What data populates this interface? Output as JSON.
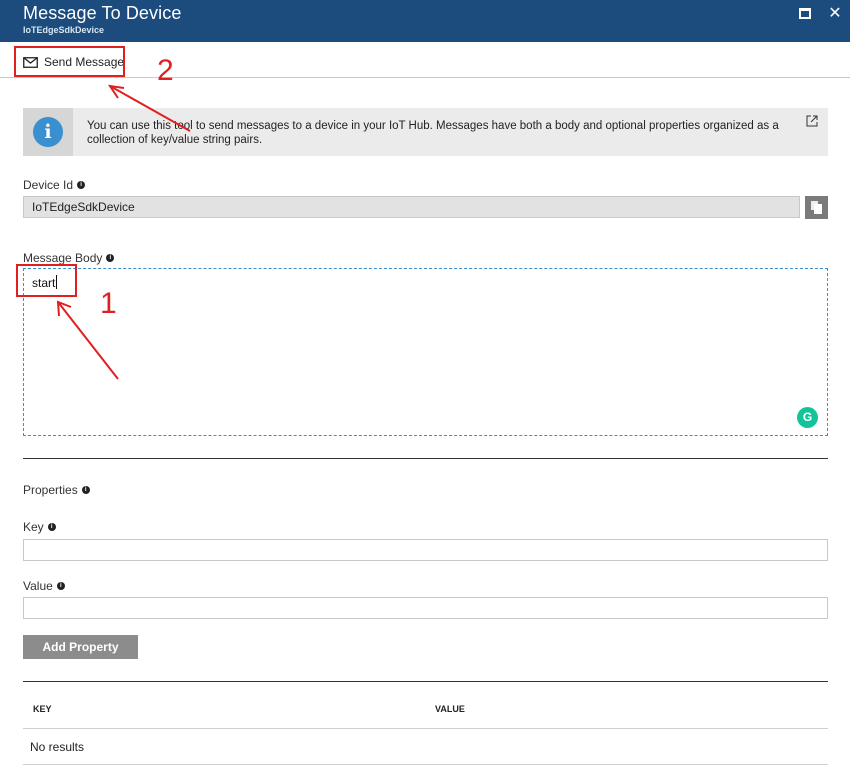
{
  "window": {
    "title": "Message To Device",
    "subtitle": "IoTEdgeSdkDevice",
    "maximize_icon": "maximize-icon",
    "close_icon": "close-icon",
    "header_color": "#1b4c7d"
  },
  "toolbar": {
    "send_label": "Send Message",
    "send_icon": "mail-icon"
  },
  "info": {
    "icon": "info-icon",
    "text": "You can use this tool to send messages to a device in your IoT Hub. Messages have both a body and optional properties organized as a collection of key/value string pairs.",
    "link_icon": "external-link-icon"
  },
  "device": {
    "label": "Device Id",
    "value": "IoTEdgeSdkDevice",
    "copy_icon": "copy-icon"
  },
  "message_body": {
    "label": "Message Body",
    "value": "start",
    "grammarly_icon": "grammarly-icon"
  },
  "properties": {
    "label": "Properties",
    "key_label": "Key",
    "key_value": "",
    "value_label": "Value",
    "value_value": "",
    "add_label": "Add Property"
  },
  "table": {
    "columns": [
      "KEY",
      "VALUE"
    ],
    "empty_text": "No results"
  },
  "annotations": {
    "one": "1",
    "two": "2",
    "color": "#e02020"
  }
}
